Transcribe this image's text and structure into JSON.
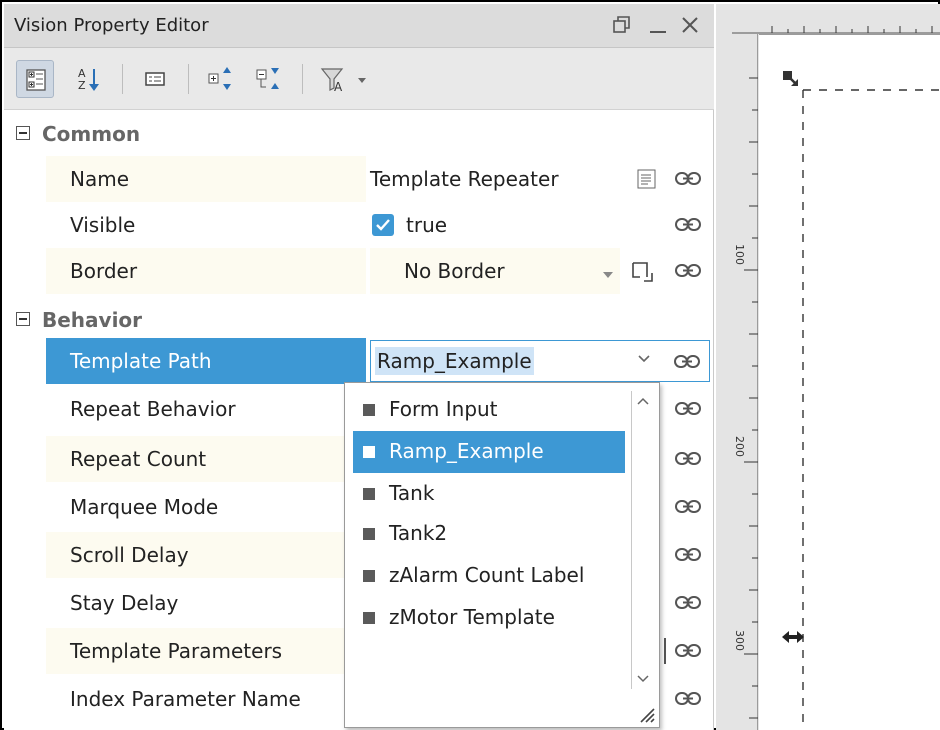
{
  "panel": {
    "title": "Vision Property Editor",
    "window_buttons": [
      "restore-icon",
      "minimize-icon",
      "close-icon"
    ]
  },
  "toolbar": {
    "tools": [
      "categorized-icon",
      "sort-alphabetical-icon",
      "property-view-icon",
      "expand-all-icon",
      "collapse-all-icon",
      "filter-icon"
    ]
  },
  "categories": {
    "common": "Common",
    "behavior": "Behavior"
  },
  "properties": {
    "name": {
      "label": "Name",
      "value": "Template Repeater"
    },
    "visible": {
      "label": "Visible",
      "value": "true",
      "checked": true
    },
    "border": {
      "label": "Border",
      "value": "No Border"
    },
    "template_path": {
      "label": "Template Path",
      "value": "Ramp_Example"
    },
    "repeat_behavior": {
      "label": "Repeat Behavior"
    },
    "repeat_count": {
      "label": "Repeat Count"
    },
    "marquee_mode": {
      "label": "Marquee Mode"
    },
    "scroll_delay": {
      "label": "Scroll Delay"
    },
    "stay_delay": {
      "label": "Stay Delay"
    },
    "template_parameters": {
      "label": "Template Parameters"
    },
    "index_parameter_name": {
      "label": "Index Parameter Name"
    }
  },
  "dropdown": {
    "items": [
      "Form Input",
      "Ramp_Example",
      "Tank",
      "Tank2",
      "zAlarm Count Label",
      "zMotor Template"
    ],
    "selected": "Ramp_Example"
  },
  "designer": {
    "ruler_labels": [
      "100",
      "200",
      "300"
    ]
  },
  "colors": {
    "selection": "#3d98d4",
    "row_tint": "#fdfbf0",
    "checkbox": "#3d98d4"
  }
}
